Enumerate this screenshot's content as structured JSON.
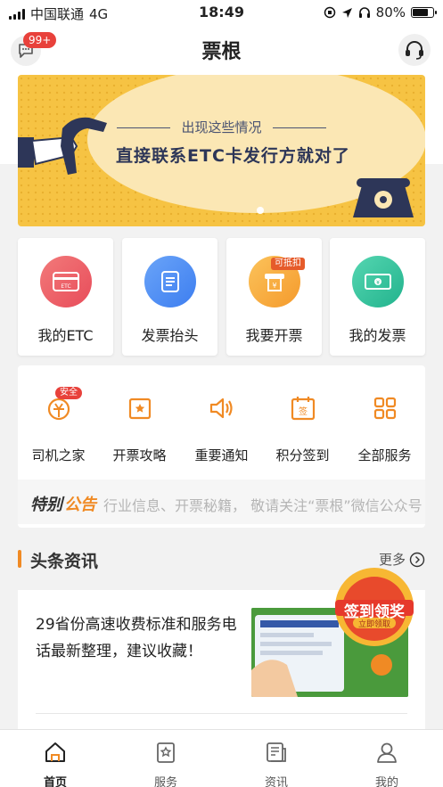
{
  "status_bar": {
    "carrier": "中国联通",
    "network": "4G",
    "time": "18:49",
    "battery_text": "80%",
    "battery_level": 0.8
  },
  "header": {
    "title": "票根",
    "message_badge": "99+"
  },
  "banner": {
    "line1": "出现这些情况",
    "line2": "直接联系ETC卡发行方就对了"
  },
  "quick_actions": [
    {
      "label": "我的ETC",
      "icon": "etc-card-icon",
      "color": "#ef5b5b"
    },
    {
      "label": "发票抬头",
      "icon": "invoice-header-icon",
      "color": "#4d8df5"
    },
    {
      "label": "我要开票",
      "icon": "issue-invoice-icon",
      "color": "#f7a93b",
      "tag": "可抵扣"
    },
    {
      "label": "我的发票",
      "icon": "my-invoice-icon",
      "color": "#2fbf9c"
    }
  ],
  "services": [
    {
      "label": "司机之家",
      "icon": "driver-home-icon",
      "badge": "安全"
    },
    {
      "label": "开票攻略",
      "icon": "invoice-guide-icon"
    },
    {
      "label": "重要通知",
      "icon": "notice-speaker-icon"
    },
    {
      "label": "积分签到",
      "icon": "checkin-calendar-icon"
    },
    {
      "label": "全部服务",
      "icon": "grid-apps-icon"
    }
  ],
  "notice": {
    "tag_part1": "特别",
    "tag_part2": "公告",
    "text": "行业信息、开票秘籍， 敬请关注“票根”微信公众号"
  },
  "headlines": {
    "title": "头条资讯",
    "more": "更多",
    "articles": [
      {
        "title": "29省份高速收费标准和服务电话最新整理，建议收藏！"
      }
    ]
  },
  "float_badge": {
    "title": "签到领奖",
    "subtitle": "立即领取"
  },
  "tabbar": [
    {
      "label": "首页",
      "icon": "home-icon",
      "active": true
    },
    {
      "label": "服务",
      "icon": "service-icon",
      "active": false
    },
    {
      "label": "资讯",
      "icon": "news-icon",
      "active": false
    },
    {
      "label": "我的",
      "icon": "profile-icon",
      "active": false
    }
  ],
  "colors": {
    "accent": "#f08a24",
    "badge_red": "#e8413b"
  }
}
